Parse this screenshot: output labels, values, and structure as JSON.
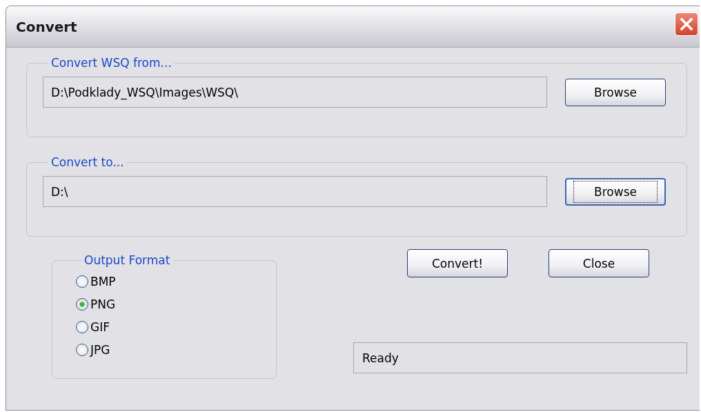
{
  "window": {
    "title": "Convert"
  },
  "source": {
    "title": "Convert WSQ from...",
    "value": "D:\\Podklady_WSQ\\Images\\WSQ\\",
    "button": {
      "label": "Browse",
      "focused": false
    }
  },
  "target": {
    "title": "Convert to...",
    "value": "D:\\",
    "button": {
      "label": "Browse",
      "focused": true
    }
  },
  "output_format": {
    "title": "Output Format",
    "options": [
      {
        "label": "BMP",
        "selected": false
      },
      {
        "label": "PNG",
        "selected": true
      },
      {
        "label": "GIF",
        "selected": false
      },
      {
        "label": "JPG",
        "selected": false
      }
    ]
  },
  "buttons": [
    "Convert!",
    "Close"
  ],
  "status": "Ready"
}
